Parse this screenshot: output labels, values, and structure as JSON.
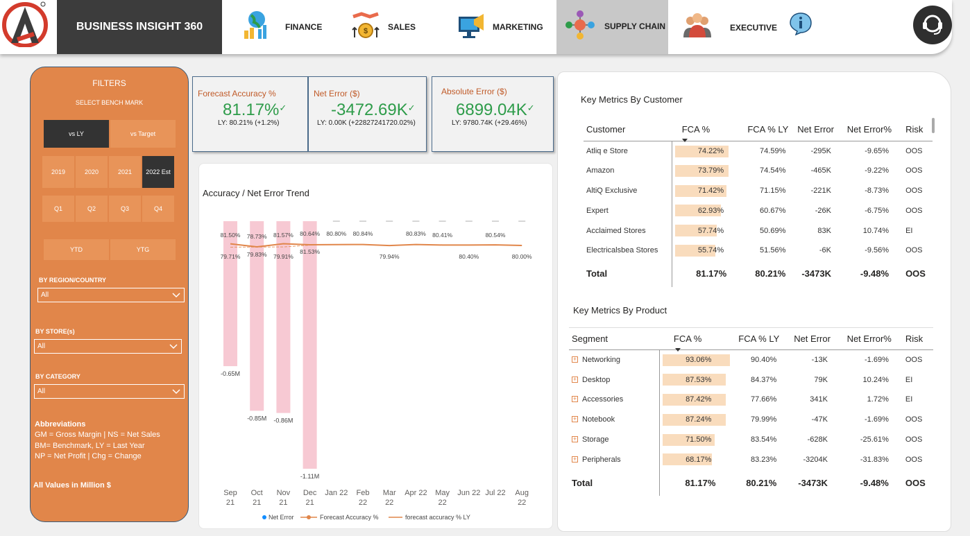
{
  "header": {
    "brand": "BUSINESS INSIGHT 360",
    "nav": [
      {
        "label": "FINANCE",
        "icon": "finance-icon"
      },
      {
        "label": "SALES",
        "icon": "sales-icon"
      },
      {
        "label": "MARKETING",
        "icon": "marketing-icon"
      },
      {
        "label": "SUPPLY CHAIN",
        "icon": "supply-chain-icon",
        "active": true
      },
      {
        "label": "EXECUTIVE",
        "icon": "executive-icon"
      }
    ],
    "info_icon": "info-icon",
    "support_icon": "headset-icon",
    "logo": "atliq-logo"
  },
  "filters": {
    "title": "FILTERS",
    "benchmark_label": "SELECT BENCH MARK",
    "benchmarks": [
      "vs LY",
      "vs Target"
    ],
    "selected_benchmark": "vs LY",
    "years": [
      "2019",
      "2020",
      "2021",
      "2022 Est"
    ],
    "selected_year": "2022 Est",
    "quarters": [
      "Q1",
      "Q2",
      "Q3",
      "Q4"
    ],
    "periods": [
      "YTD",
      "YTG"
    ],
    "region_label": "BY REGION/COUNTRY",
    "region_value": "All",
    "store_label": "BY STORE(s)",
    "store_value": "All",
    "category_label": "BY CATEGORY",
    "category_value": "All",
    "abbr_title": "Abbreviations",
    "abbr_lines": [
      "GM = Gross Margin | NS = Net  Sales",
      "BM= Benchmark, LY = Last Year",
      "NP = Net Profit | Chg = Change"
    ],
    "note": "All Values in Million $"
  },
  "kpis": [
    {
      "title": "Forecast Accuracy %",
      "value": "81.17%",
      "sub": "LY: 80.21% (+1.2%)"
    },
    {
      "title": "Net Error ($)",
      "value": "-3472.69K",
      "sub": "LY: 0.00K (+22827241720.02%)"
    },
    {
      "title": "Absolute Error ($)",
      "value": "6899.04K",
      "sub": "LY: 9780.74K (+29.46%)"
    }
  ],
  "chart": {
    "title": "Accuracy / Net Error Trend",
    "legend": [
      "Net Error",
      "Forecast Accuracy %",
      "forecast accuracy % LY"
    ],
    "legend_colors": [
      "#118dff",
      "#e1864a",
      "#e1864a"
    ],
    "bar_color": "#f7c9d3",
    "line_color": "#e1864a"
  },
  "chart_data": {
    "type": "bar",
    "categories": [
      "Sep 21",
      "Oct 21",
      "Nov 21",
      "Dec 21",
      "Jan 22",
      "Feb 22",
      "Mar 22",
      "Apr 22",
      "May 22",
      "Jun 22",
      "Jul 22",
      "Aug 22"
    ],
    "series": [
      {
        "name": "Net Error",
        "values": [
          -0.65,
          -0.85,
          -0.86,
          -1.11,
          null,
          null,
          null,
          null,
          null,
          null,
          null,
          null
        ],
        "labels": [
          "-0.65M",
          "-0.85M",
          "-0.86M",
          "-1.11M",
          "",
          "",
          "",
          "",
          "",
          "",
          "",
          ""
        ]
      },
      {
        "name": "Forecast Accuracy %",
        "values": [
          81.5,
          78.73,
          81.57,
          80.64,
          80.8,
          80.84,
          79.94,
          80.83,
          80.41,
          80.4,
          80.54,
          80.0
        ],
        "labels": [
          "81.50%",
          "78.73%",
          "81.57%",
          "80.64%",
          "80.80%",
          "80.84%",
          "79.94%",
          "80.83%",
          "80.41%",
          "80.40%",
          "80.54%",
          "80.00%"
        ]
      },
      {
        "name": "forecast accuracy % LY",
        "values": [
          79.71,
          79.83,
          79.91,
          81.53,
          null,
          null,
          null,
          null,
          null,
          null,
          null,
          null
        ],
        "labels": [
          "79.71%",
          "79.83%",
          "79.91%",
          "81.53%",
          "",
          "",
          "",
          "",
          "",
          "",
          "",
          ""
        ]
      }
    ]
  },
  "customer_table": {
    "title": "Key Metrics By Customer",
    "columns": [
      "Customer",
      "FCA %",
      "FCA % LY",
      "Net Error",
      "Net Error%",
      "Risk"
    ],
    "rows": [
      [
        "Atliq e Store",
        "74.22%",
        "74.59%",
        "-295K",
        "-9.65%",
        "OOS"
      ],
      [
        "Amazon",
        "73.79%",
        "74.54%",
        "-465K",
        "-9.22%",
        "OOS"
      ],
      [
        "AltiQ Exclusive",
        "71.42%",
        "71.15%",
        "-221K",
        "-8.73%",
        "OOS"
      ],
      [
        "Expert",
        "62.93%",
        "60.67%",
        "-26K",
        "-6.75%",
        "OOS"
      ],
      [
        "Acclaimed Stores",
        "57.74%",
        "50.69%",
        "83K",
        "10.74%",
        "EI"
      ],
      [
        "Electricalsbea Stores",
        "55.74%",
        "51.56%",
        "-6K",
        "-9.56%",
        "OOS"
      ]
    ],
    "total": [
      "Total",
      "81.17%",
      "80.21%",
      "-3473K",
      "-9.48%",
      "OOS"
    ]
  },
  "product_table": {
    "title": "Key Metrics By Product",
    "columns": [
      "Segment",
      "FCA %",
      "FCA % LY",
      "Net Error",
      "Net Error%",
      "Risk"
    ],
    "rows": [
      [
        "Networking",
        "93.06%",
        "90.40%",
        "-13K",
        "-1.69%",
        "OOS"
      ],
      [
        "Desktop",
        "87.53%",
        "84.37%",
        "79K",
        "10.24%",
        "EI"
      ],
      [
        "Accessories",
        "87.42%",
        "77.66%",
        "341K",
        "1.72%",
        "EI"
      ],
      [
        "Notebook",
        "87.24%",
        "79.99%",
        "-47K",
        "-1.69%",
        "OOS"
      ],
      [
        "Storage",
        "71.50%",
        "83.54%",
        "-628K",
        "-25.61%",
        "OOS"
      ],
      [
        "Peripherals",
        "68.17%",
        "83.23%",
        "-3204K",
        "-31.83%",
        "OOS"
      ]
    ],
    "total": [
      "Total",
      "81.17%",
      "80.21%",
      "-3473K",
      "-9.48%",
      "OOS"
    ]
  }
}
